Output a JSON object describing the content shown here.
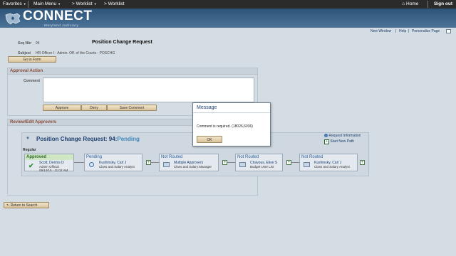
{
  "topbar": {
    "favorites": "Favorites",
    "main_menu": "Main Menu",
    "worklist_menu": "Worklist",
    "worklist": "Worklist",
    "home": "Home",
    "sign_out": "Sign out"
  },
  "brand": {
    "name": "CONNECT",
    "subtitle": "Maryland Judiciary"
  },
  "utility_links": {
    "new_window": "New Window",
    "help": "Help",
    "personalize_page": "Personalize Page"
  },
  "form": {
    "seq_label": "Seq Nbr",
    "seq_value": "94",
    "title": "Position Change Request",
    "subject_label": "Subject",
    "subject_value": "HR Officer I - Admin. Off. of the Courts - POSCHG",
    "go_to_form": "Go to Form"
  },
  "approval_action": {
    "header": "Approval Action",
    "comment_label": "Comment",
    "comment_value": "",
    "approve": "Approve",
    "deny": "Deny",
    "save_comment": "Save Comment"
  },
  "review": {
    "header": "Review/Edit Approvers",
    "request_title": "Position Change Request: 94:",
    "request_status": "Pending",
    "request_information": "Request Information",
    "start_new_path": "Start New Path",
    "path_label": "Regular",
    "steps": [
      {
        "status": "Approved",
        "name": "Scott, Dennis D",
        "role": "Admin Official",
        "detail": "09/14/15 - 11:02 AM"
      },
      {
        "status": "Pending",
        "name": "Kushinsky, Carl J",
        "role": "Class and Salary Analyst",
        "detail": ""
      },
      {
        "status": "Not Routed",
        "name": "Multiple Approvers",
        "role": "Class and Salary Manager",
        "detail": ""
      },
      {
        "status": "Not Routed",
        "name": "Chavous, Elise S",
        "role": "Budget User List",
        "detail": ""
      },
      {
        "status": "Not Routed",
        "name": "Kushinsky, Carl J",
        "role": "Class and Salary Analyst",
        "detail": ""
      }
    ],
    "add_symbol": "+"
  },
  "return_to_search": "Return to Search",
  "dialog": {
    "title": "Message",
    "message": "Comment is required. (18026,6036)",
    "ok": "OK"
  },
  "colors": {
    "banner": "#3b6287",
    "approved_header": "#cfe7c2",
    "approved_text": "#2d6a2d",
    "pending_text": "#1b5e9c",
    "section_header_text": "#8a4b3a"
  }
}
